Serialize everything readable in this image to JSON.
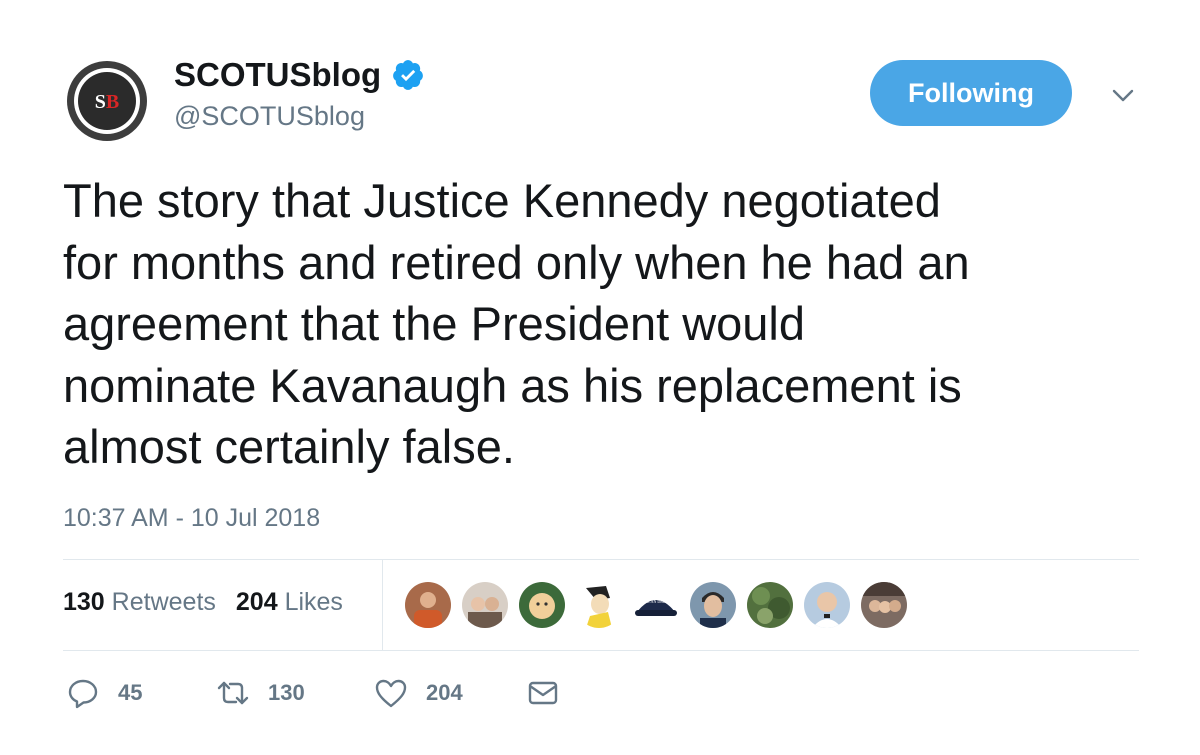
{
  "account": {
    "avatar_text": "SB",
    "display_name": "SCOTUSblog",
    "handle": "@SCOTUSblog",
    "verified": true
  },
  "follow_button": {
    "label": "Following"
  },
  "tweet": {
    "text": "The story that Justice Kennedy negotiated\nfor months and retired only when he had an\nagreement that the President would\nnominate Kavanaugh as his replacement is\nalmost certainly false.",
    "timestamp": "10:37 AM - 10 Jul 2018"
  },
  "stats": {
    "retweets_count": "130",
    "retweets_label": "Retweets",
    "likes_count": "204",
    "likes_label": "Likes"
  },
  "likers": [
    {
      "name": "liker-1",
      "bg": "#c97b5a"
    },
    {
      "name": "liker-2",
      "bg": "#b8a899"
    },
    {
      "name": "liker-3",
      "bg": "#e8c07a"
    },
    {
      "name": "liker-4",
      "bg": "#f2d23a"
    },
    {
      "name": "liker-5",
      "bg": "#1d2a4a",
      "hat_text": "AMERICAN DREAMER"
    },
    {
      "name": "liker-6",
      "bg": "#5a6f8a"
    },
    {
      "name": "liker-7",
      "bg": "#5f7a48"
    },
    {
      "name": "liker-8",
      "bg": "#9ab4cf"
    },
    {
      "name": "liker-9",
      "bg": "#6b5a52"
    }
  ],
  "actions": {
    "reply_count": "45",
    "retweet_count": "130",
    "like_count": "204"
  },
  "colors": {
    "accent": "#4aa6e6",
    "muted": "#657786",
    "text": "#14171a",
    "divider": "#e1e8ed"
  }
}
